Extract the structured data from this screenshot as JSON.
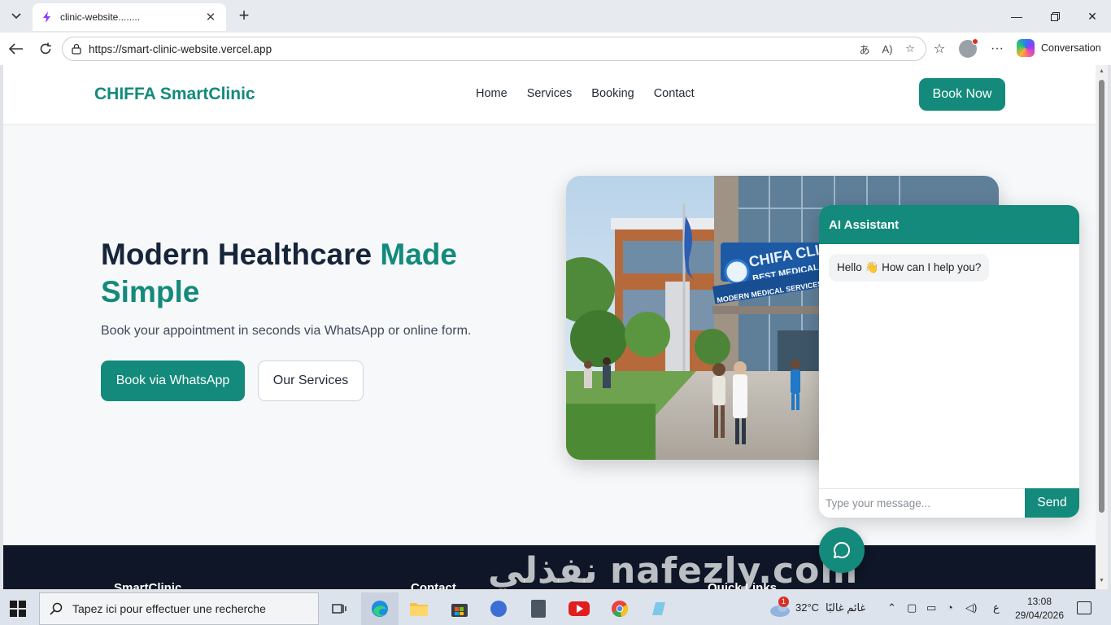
{
  "browser": {
    "tab_title": "clinic-website........",
    "url": "https://smart-clinic-website.vercel.app",
    "copilot_label": "Conversation"
  },
  "site": {
    "brand": "CHIFFA SmartClinic",
    "nav": [
      "Home",
      "Services",
      "Booking",
      "Contact"
    ],
    "book_now": "Book Now",
    "hero": {
      "title_main": "Modern Healthcare ",
      "title_accent": "Made Simple",
      "subtitle": "Book your appointment in seconds via WhatsApp or online form.",
      "btn_whatsapp": "Book via WhatsApp",
      "btn_services": "Our Services"
    },
    "image_signs": {
      "sign1": "CHIFA CLINIC",
      "sign2": "BEST MEDICAL",
      "sign3": "MODERN MEDICAL SERVICES W"
    },
    "footer_headings": [
      "SmartClinic",
      "Contact",
      "Quick Links"
    ],
    "chat": {
      "title": "AI Assistant",
      "greeting": "Hello 👋 How can I help you?",
      "placeholder": "Type your message...",
      "send": "Send"
    },
    "watermark": "نفذلي nafezly.com"
  },
  "taskbar": {
    "search_placeholder": "Tapez ici pour effectuer une recherche",
    "weather": "32°C",
    "weather_desc": "غائم غالبًا",
    "lang": "ع",
    "time": "13:08",
    "date": "29/04/2026",
    "weather_badge": "1"
  },
  "colors": {
    "brand": "#138a7b",
    "dark_text": "#17253a",
    "footer": "#0e1627"
  }
}
